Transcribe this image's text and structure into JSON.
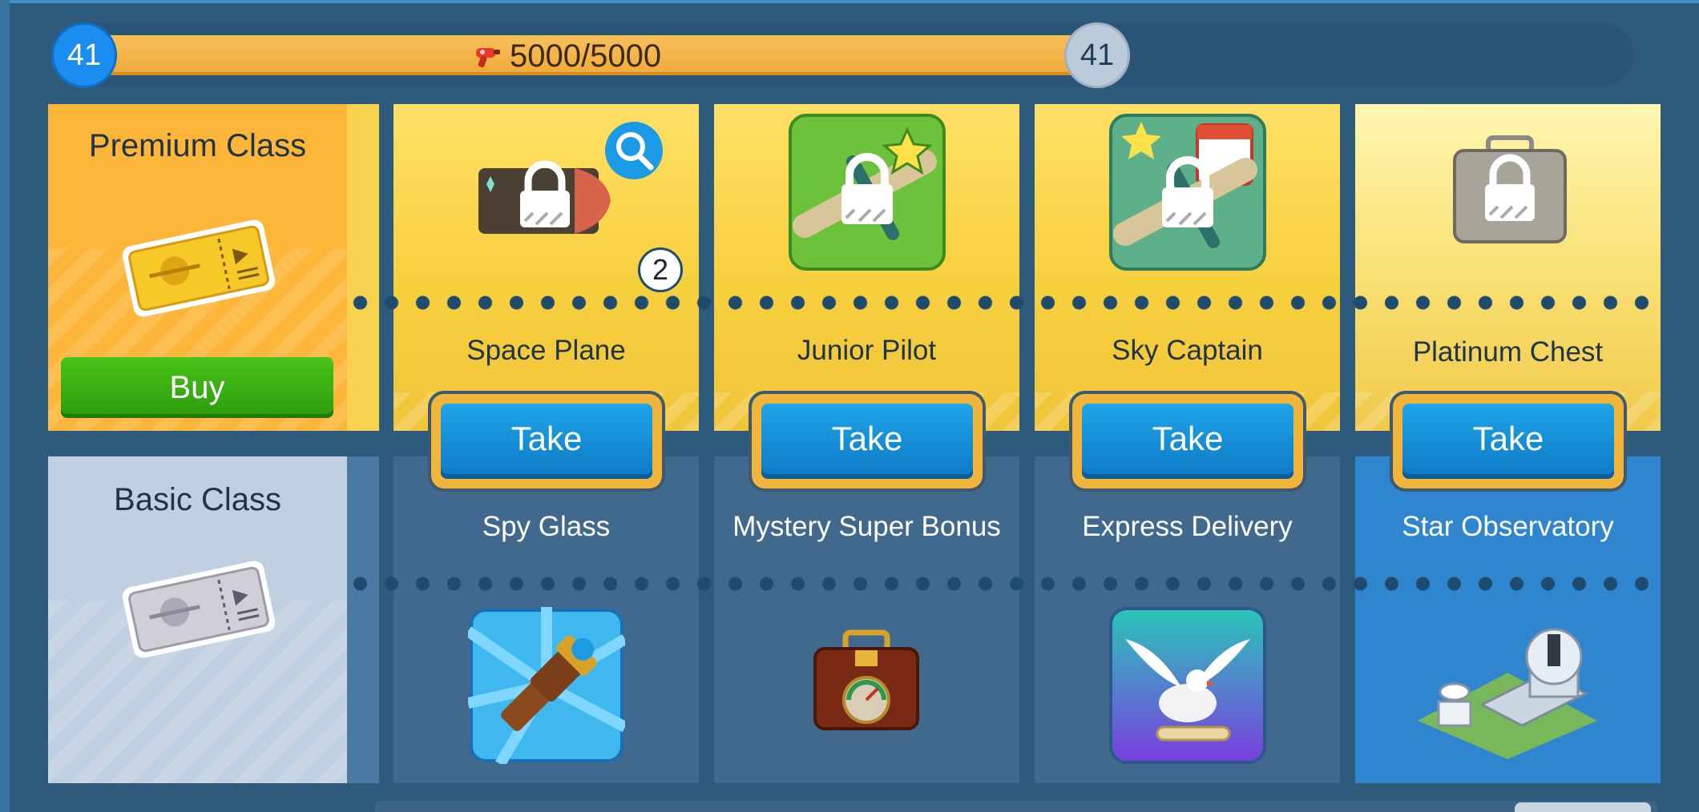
{
  "progress": {
    "level_current": "41",
    "level_next": "41",
    "value_text": "5000/5000",
    "fill_fraction": 1.0,
    "currency_icon": "ray-gun-icon"
  },
  "classes": {
    "premium": {
      "title": "Premium Class",
      "buy_label": "Buy",
      "icon": "gold-ticket-icon"
    },
    "basic": {
      "title": "Basic Class",
      "icon": "silver-ticket-icon"
    }
  },
  "rewards": [
    {
      "premium_name": "Space Plane",
      "take_label": "Take",
      "basic_name": "Spy Glass",
      "premium_icon": "locked-space-plane-icon",
      "basic_icon": "spyglass-icon",
      "badge": "2"
    },
    {
      "premium_name": "Junior Pilot",
      "take_label": "Take",
      "basic_name": "Mystery Super Bonus",
      "premium_icon": "locked-junior-pilot-icon",
      "basic_icon": "mystery-chest-icon"
    },
    {
      "premium_name": "Sky Captain",
      "take_label": "Take",
      "basic_name": "Express Delivery",
      "premium_icon": "locked-sky-captain-icon",
      "basic_icon": "dove-icon"
    },
    {
      "premium_name": "Platinum Chest",
      "take_label": "Take",
      "basic_name": "Star Observatory",
      "premium_icon": "locked-platinum-chest-icon",
      "basic_icon": "observatory-icon"
    }
  ],
  "colors": {
    "accent": "#1b8cf0",
    "progress": "#f5b949",
    "premium": "#fdb53a",
    "take": "#1394da",
    "buy": "#3cae13"
  }
}
